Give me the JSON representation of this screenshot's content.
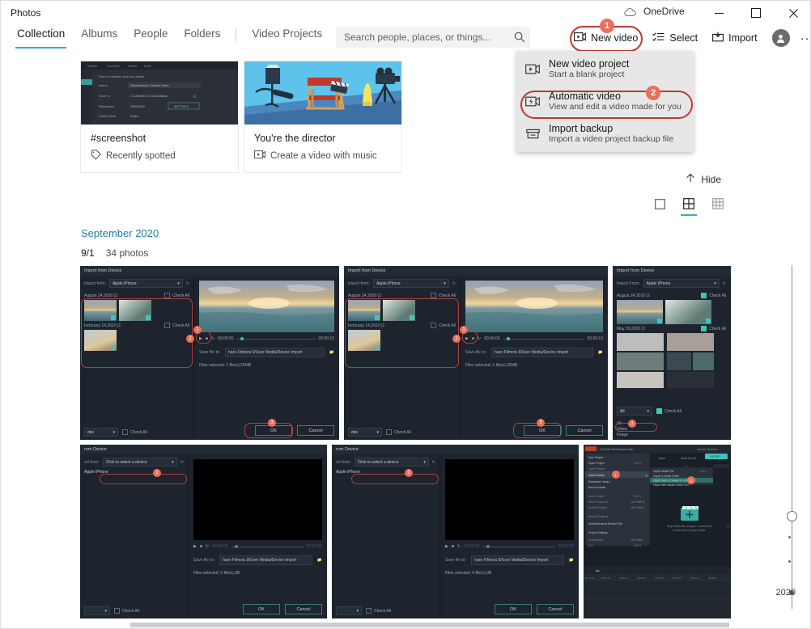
{
  "window": {
    "app_title": "Photos",
    "onedrive_label": "OneDrive",
    "onedrive_icon": "cloud-icon",
    "minimize_icon": "minimize-icon",
    "maximize_icon": "maximize-icon",
    "close_icon": "close-icon"
  },
  "tabs": [
    {
      "label": "Collection",
      "active": true
    },
    {
      "label": "Albums",
      "active": false
    },
    {
      "label": "People",
      "active": false
    },
    {
      "label": "Folders",
      "active": false
    },
    {
      "label": "Video Projects",
      "active": false
    }
  ],
  "search": {
    "placeholder": "Search people, places, or things...",
    "value": "",
    "icon": "search-icon"
  },
  "commands": {
    "new_video": {
      "label": "New video",
      "icon": "new-video-icon",
      "badge": "1"
    },
    "select": {
      "label": "Select",
      "icon": "select-icon"
    },
    "import": {
      "label": "Import",
      "icon": "import-icon"
    },
    "account": {
      "icon": "account-avatar-icon"
    },
    "more": {
      "label": "···",
      "icon": "more-icon"
    }
  },
  "menu": {
    "items": [
      {
        "title": "New video project",
        "subtitle": "Start a blank project",
        "icon": "video-project-icon",
        "highlighted": false
      },
      {
        "title": "Automatic video",
        "subtitle": "View and edit a video made for you",
        "icon": "automatic-video-icon",
        "highlighted": true,
        "badge": "2"
      },
      {
        "title": "Import backup",
        "subtitle": "Import a video project backup file",
        "icon": "import-backup-icon",
        "highlighted": false
      }
    ]
  },
  "cards": [
    {
      "title": "#screenshot",
      "subtitle": "Recently spotted",
      "sub_icon": "tag-icon",
      "image": "screenshot-export-dialog-thumbnail"
    },
    {
      "title": "You're the director",
      "subtitle": "Create a video with music",
      "sub_icon": "video-icon",
      "image": "director-illustration-thumbnail"
    }
  ],
  "toolbar": {
    "hide_label": "Hide",
    "hide_icon": "chevron-up-icon",
    "views": [
      {
        "name": "single-photo-view",
        "icon": "square-icon",
        "active": false
      },
      {
        "name": "medium-grid-view",
        "icon": "grid-4-icon",
        "active": true
      },
      {
        "name": "small-grid-view",
        "icon": "grid-9-icon",
        "active": false
      }
    ]
  },
  "section": {
    "title": "September 2020",
    "date": "9/1",
    "count": "34 photos"
  },
  "photos": {
    "row1": [
      {
        "name": "import-from-device-dialog-1",
        "dialog_title": "Import from Device",
        "import_from_label": "Import from:",
        "device": "Apple iPhone",
        "group1": "August 24,2020 (2",
        "group2": "February 14,2020 (1",
        "check_all": "Check All",
        "time_start": "00:00:00",
        "time_end": "00:00:10",
        "save_label": "Save file to:",
        "save_path": "hare Filmora 9/User Media/Device Import",
        "files_label": "Files selected:  1 file(s),25MB",
        "ok": "OK",
        "cancel": "Cancel",
        "filter": "deo",
        "badges": [
          "1",
          "2",
          "3"
        ]
      },
      {
        "name": "import-from-device-dialog-2",
        "dialog_title": "Import from Device",
        "import_from_label": "Import from:",
        "device": "Apple iPhone",
        "group1": "August 24,2020 (2",
        "group2": "February 14,2020 (1",
        "check_all": "Check All",
        "time_start": "00:00:00",
        "time_end": "00:00:10",
        "save_label": "Save file to:",
        "save_path": "hare Filmora 9/User Media/Device Import",
        "files_label": "Files selected:  1 file(s),25MB",
        "ok": "OK",
        "cancel": "Cancel",
        "filter": "deo",
        "badges": [
          "1",
          "2",
          "3"
        ]
      },
      {
        "name": "import-from-device-dialog-3",
        "dialog_title": "Import from Device",
        "import_from_label": "Import From:",
        "device": "Apple iPhone",
        "group1": "August 24,2020 (2",
        "group2": "May 29,2020 (3",
        "check_all": "Check All",
        "filter": "All",
        "filter_options": [
          "All",
          "Video",
          "Image"
        ],
        "badges": [
          "1"
        ]
      }
    ],
    "row2": [
      {
        "name": "import-from-device-dialog-4",
        "dialog_title": "rom Device",
        "import_from_label": "ort from:",
        "device_placeholder": "Click to select a device",
        "device_option": "Apple iPhone",
        "check_all": "Check All",
        "save_label": "Save file to:",
        "save_path": "hare Filmora 9/User Media/Device Import",
        "files_label": "Files selected:  0 file(s),0B",
        "ok": "OK",
        "cancel": "Cancel",
        "badges": [
          "1"
        ]
      },
      {
        "name": "import-from-device-dialog-5",
        "dialog_title": "rom Device",
        "import_from_label": "ort from:",
        "device_placeholder": "Click to select a device",
        "device_option": "Apple iPhone",
        "check_all": "Check All",
        "save_label": "Save file to:",
        "save_path": "hare Filmora 9/User Media/Device Import",
        "files_label": "Files selected:  0 file(s),0B",
        "ok": "OK",
        "cancel": "Cancel",
        "badges": [
          "1"
        ]
      },
      {
        "name": "filmora-editor-screenshot",
        "menu_label": "Import Media",
        "center_text": "Drop media files, images, or audio here, or click here to import media."
      }
    ]
  },
  "timeline": {
    "year": "2020"
  }
}
